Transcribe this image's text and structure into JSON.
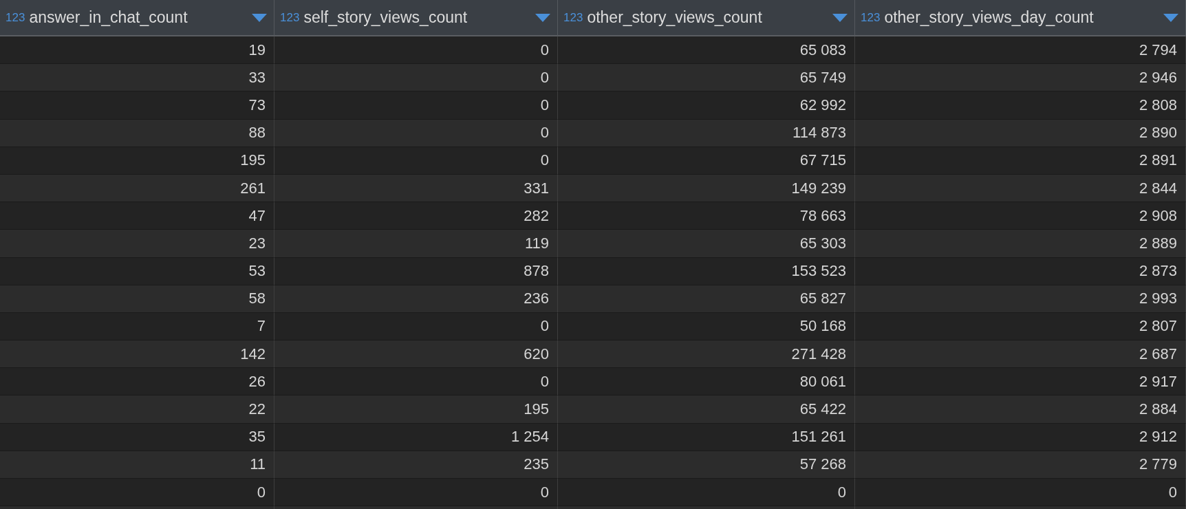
{
  "table": {
    "columns": [
      {
        "type_label": "123",
        "name": "answer_in_chat_count"
      },
      {
        "type_label": "123",
        "name": "self_story_views_count"
      },
      {
        "type_label": "123",
        "name": "other_story_views_count"
      },
      {
        "type_label": "123",
        "name": "other_story_views_day_count"
      }
    ],
    "rows": [
      [
        "19",
        "0",
        "65 083",
        "2 794"
      ],
      [
        "33",
        "0",
        "65 749",
        "2 946"
      ],
      [
        "73",
        "0",
        "62 992",
        "2 808"
      ],
      [
        "88",
        "0",
        "114 873",
        "2 890"
      ],
      [
        "195",
        "0",
        "67 715",
        "2 891"
      ],
      [
        "261",
        "331",
        "149 239",
        "2 844"
      ],
      [
        "47",
        "282",
        "78 663",
        "2 908"
      ],
      [
        "23",
        "119",
        "65 303",
        "2 889"
      ],
      [
        "53",
        "878",
        "153 523",
        "2 873"
      ],
      [
        "58",
        "236",
        "65 827",
        "2 993"
      ],
      [
        "7",
        "0",
        "50 168",
        "2 807"
      ],
      [
        "142",
        "620",
        "271 428",
        "2 687"
      ],
      [
        "26",
        "0",
        "80 061",
        "2 917"
      ],
      [
        "22",
        "195",
        "65 422",
        "2 884"
      ],
      [
        "35",
        "1 254",
        "151 261",
        "2 912"
      ],
      [
        "11",
        "235",
        "57 268",
        "2 779"
      ],
      [
        "0",
        "0",
        "0",
        "0"
      ]
    ]
  }
}
